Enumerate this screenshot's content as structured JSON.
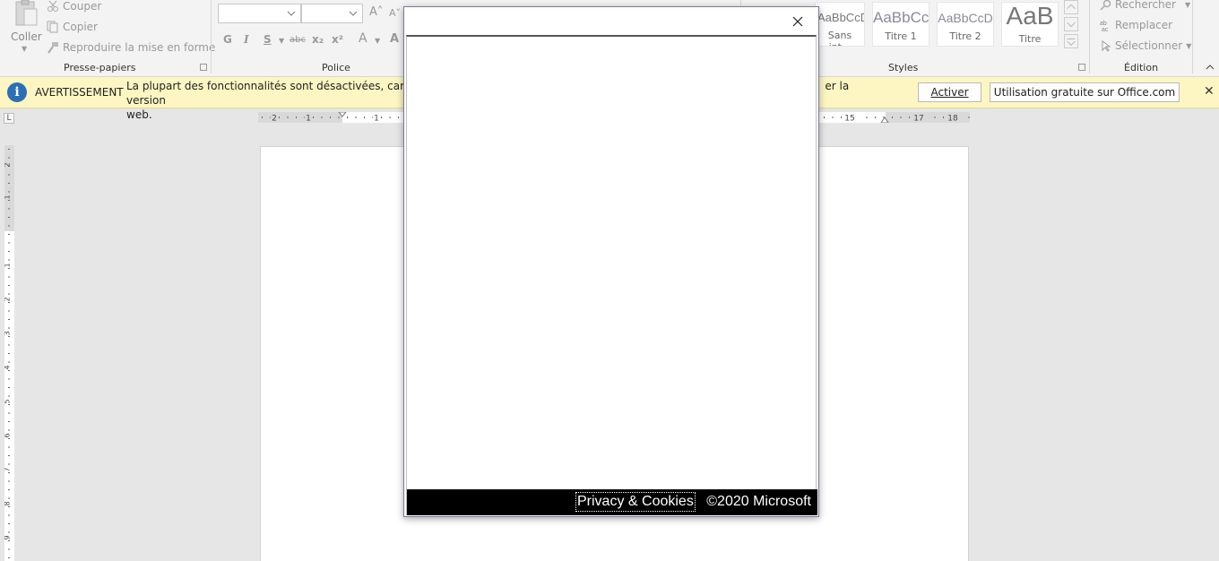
{
  "ribbon": {
    "clipboard": {
      "paste_label": "Coller",
      "cut_label": "Couper",
      "copy_label": "Copier",
      "format_painter_label": "Reproduire la mise en forme",
      "group_label": "Presse-papiers"
    },
    "font": {
      "bold": "G",
      "italic": "I",
      "underline": "S",
      "strikethrough": "abc",
      "subscript": "x₂",
      "superscript": "x²",
      "grow_font": "A˄",
      "shrink_font": "A˅",
      "text_effects": "A",
      "font_color": "A",
      "group_label": "Police"
    },
    "styles": {
      "items": [
        {
          "sample": "AaBbCcDc",
          "name": "Sans int..."
        },
        {
          "sample": "AaBbCc",
          "name": "Titre 1"
        },
        {
          "sample": "AaBbCcD",
          "name": "Titre 2"
        },
        {
          "sample": "AaB",
          "name": "Titre"
        }
      ],
      "group_label": "Styles"
    },
    "editing": {
      "find_label": "Rechercher",
      "replace_label": "Remplacer",
      "select_label": "Sélectionner",
      "group_label": "Édition"
    }
  },
  "warning": {
    "title": "AVERTISSEMENT",
    "message_start": "La plupart des fonctionnalités sont désactivées, car votre pr",
    "message_end": "er la version",
    "message_line2": "web.",
    "activate_label": "Activer",
    "office_label": "Utilisation gratuite sur Office.com",
    "close_glyph": "✕"
  },
  "ruler": {
    "corner_glyph": "L",
    "h_labels": [
      "2",
      "1",
      "1",
      "15",
      "17",
      "18"
    ],
    "v_labels": [
      "2",
      "1",
      "1",
      "2",
      "3",
      "4",
      "5",
      "6",
      "7",
      "8",
      "9"
    ]
  },
  "dialog": {
    "close_glyph": "✕",
    "privacy_label": "Privacy & Cookies",
    "copyright": "©2020 Microsoft"
  },
  "colors": {
    "warning_bg": "#fdf6c3",
    "info_blue": "#2b6fb4",
    "footer_bg": "#000000"
  }
}
